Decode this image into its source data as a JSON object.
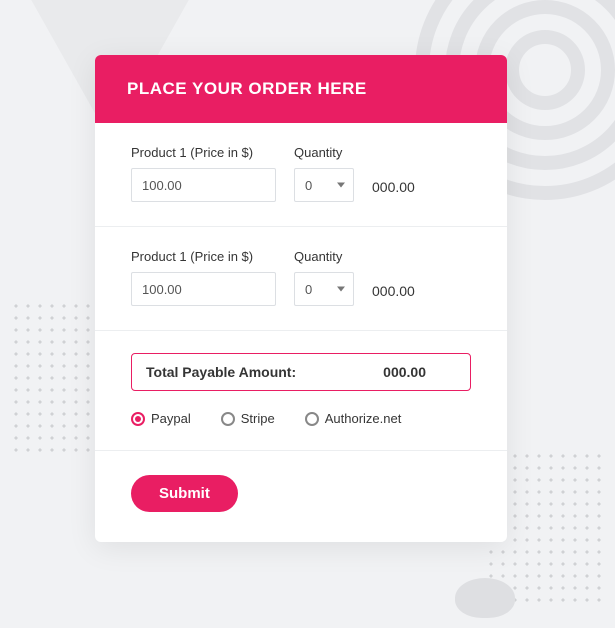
{
  "header": {
    "title": "PLACE YOUR ORDER HERE"
  },
  "products": [
    {
      "label": "Product 1 (Price in $)",
      "price": "100.00",
      "qty_label": "Quantity",
      "qty_value": "0",
      "line_total": "000.00"
    },
    {
      "label": "Product 1 (Price in $)",
      "price": "100.00",
      "qty_label": "Quantity",
      "qty_value": "0",
      "line_total": "000.00"
    }
  ],
  "total": {
    "label": "Total Payable Amount:",
    "value": "000.00"
  },
  "payment": {
    "options": [
      {
        "label": "Paypal",
        "selected": true
      },
      {
        "label": "Stripe",
        "selected": false
      },
      {
        "label": "Authorize.net",
        "selected": false
      }
    ]
  },
  "submit": {
    "label": "Submit"
  }
}
